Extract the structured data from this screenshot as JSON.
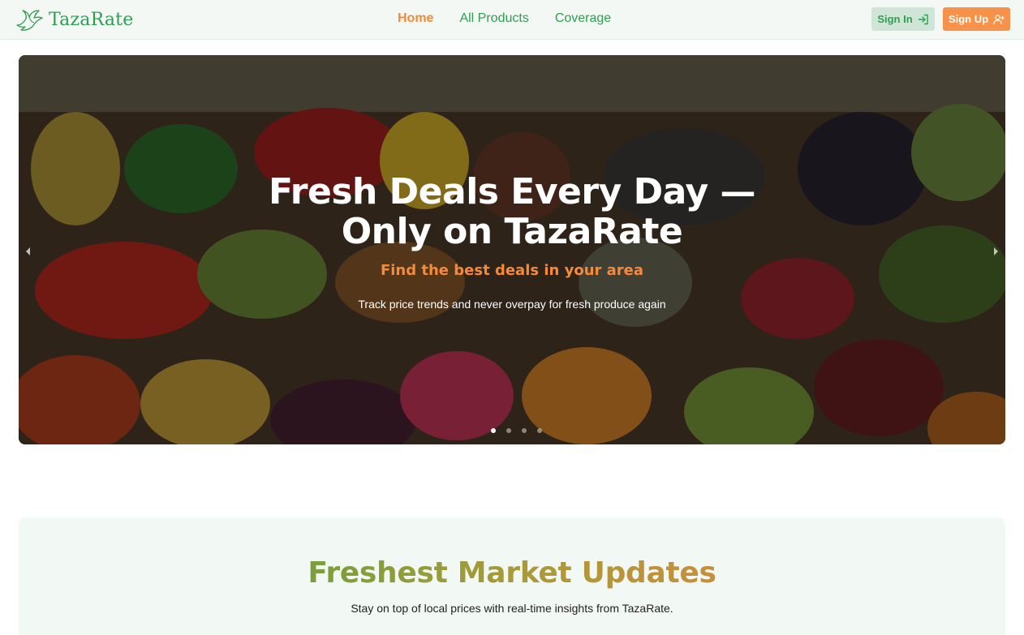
{
  "brand": {
    "name": "TazaRate",
    "icon": "dove-icon",
    "color": "#2f9e52"
  },
  "nav": {
    "links": [
      {
        "label": "Home",
        "active": true
      },
      {
        "label": "All Products",
        "active": false
      },
      {
        "label": "Coverage",
        "active": false
      }
    ],
    "sign_in": {
      "label": "Sign In",
      "icon": "login-arrow-icon"
    },
    "sign_up": {
      "label": "Sign Up",
      "icon": "user-plus-icon"
    }
  },
  "hero": {
    "title": "Fresh Deals Every Day — Only on TazaRate",
    "subtitle": "Find the best deals in your area",
    "description": "Track price trends and never overpay for fresh produce again",
    "slide_count": 4,
    "active_slide": 1,
    "prev_icon": "chevron-left-icon",
    "next_icon": "chevron-right-icon"
  },
  "market": {
    "title": "Freshest Market Updates",
    "subtitle": "Stay on top of local prices with real-time insights from TazaRate."
  },
  "colors": {
    "accent_orange": "#f7924a",
    "primary_green": "#2f9e52",
    "signin_bg": "#cfe6d7",
    "navbar_bg": "#f3f8f4",
    "section_bg": "#f2f8f3"
  }
}
